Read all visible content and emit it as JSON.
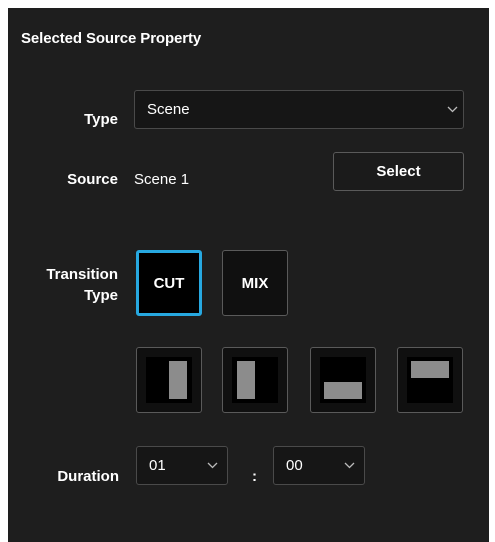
{
  "panel": {
    "title": "Selected Source Property"
  },
  "type_row": {
    "label": "Type",
    "value": "Scene"
  },
  "source_row": {
    "label": "Source",
    "value": "Scene 1",
    "select_label": "Select"
  },
  "transition": {
    "label_line1": "Transition",
    "label_line2": "Type",
    "cut_label": "CUT",
    "mix_label": "MIX",
    "selected": "CUT",
    "wipes": [
      {
        "name": "wipe-vertical-right-icon"
      },
      {
        "name": "wipe-vertical-left-icon"
      },
      {
        "name": "wipe-horizontal-bottom-icon"
      },
      {
        "name": "wipe-horizontal-top-icon"
      }
    ],
    "accent_color": "#27a8e0"
  },
  "duration": {
    "label": "Duration",
    "seconds": "01",
    "separator": ":",
    "frames": "00"
  }
}
